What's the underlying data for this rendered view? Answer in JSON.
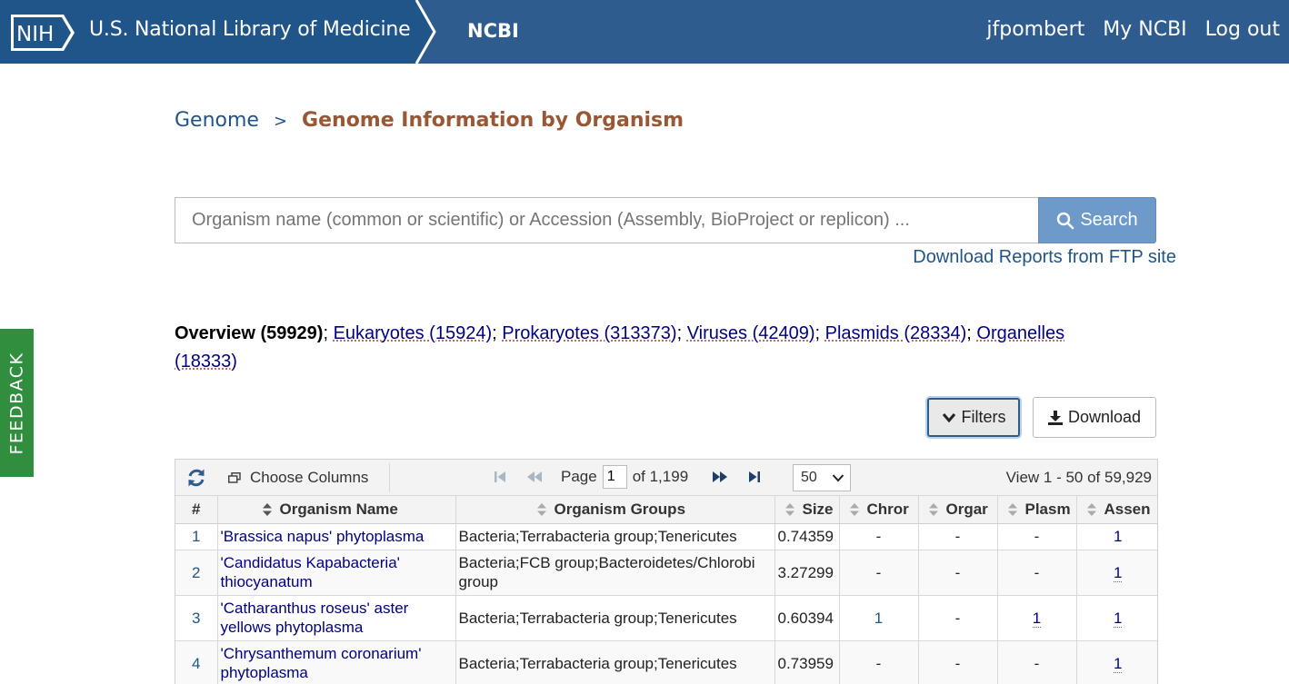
{
  "header": {
    "nih_logo": "NIH",
    "nih_title": "U.S. National Library of Medicine",
    "ncbi": "NCBI",
    "user": "jfpombert",
    "my_ncbi": "My NCBI",
    "logout": "Log out"
  },
  "breadcrumb": {
    "parent": "Genome",
    "separator": ">",
    "current": "Genome Information by Organism"
  },
  "search": {
    "placeholder": "Organism name (common or scientific) or Accession (Assembly, BioProject or replicon) ...",
    "button_label": "Search",
    "ftp_link": "Download Reports from FTP site"
  },
  "overview": {
    "current": "Overview (59929)",
    "links": [
      "Eukaryotes (15924)",
      "Prokaryotes (313373)",
      "Viruses (42409)",
      "Plasmids (28334)",
      "Organelles (18333)"
    ]
  },
  "actions": {
    "filters": "Filters",
    "download": "Download"
  },
  "feedback": "FEEDBACK",
  "grid": {
    "toolbar": {
      "choose_columns": "Choose Columns",
      "page_label": "Page",
      "page_value": "1",
      "of_pages": "of 1,199",
      "rows_per_page": "50",
      "view_count": "View 1 - 50 of 59,929"
    },
    "columns": [
      "#",
      "Organism Name",
      "Organism Groups",
      "Size",
      "Chror",
      "Orgar",
      "Plasm",
      "Assen"
    ],
    "rows": [
      [
        "1",
        "'Brassica napus' phytoplasma",
        "Bacteria;Terrabacteria group;Tenericutes",
        "0.74359",
        "-",
        "-",
        "-",
        "1"
      ],
      [
        "2",
        "'Candidatus Kapabacteria' thiocyanatum",
        "Bacteria;FCB group;Bacteroidetes/Chlorobi group",
        "3.27299",
        "-",
        "-",
        "-",
        "1"
      ],
      [
        "3",
        "'Catharanthus roseus' aster yellows phytoplasma",
        "Bacteria;Terrabacteria group;Tenericutes",
        "0.60394",
        "1",
        "-",
        "1",
        "1"
      ],
      [
        "4",
        "'Chrysanthemum coronarium' phytoplasma",
        "Bacteria;Terrabacteria group;Tenericutes",
        "0.73959",
        "-",
        "-",
        "-",
        "1"
      ]
    ]
  },
  "colors": {
    "nih_blue": "#20558a",
    "header_blue": "#2e5c8e",
    "breadcrumb_current": "#985735",
    "search_button": "#6d9ac9",
    "feedback_green": "#328e3f",
    "link_navy": "#000080"
  }
}
